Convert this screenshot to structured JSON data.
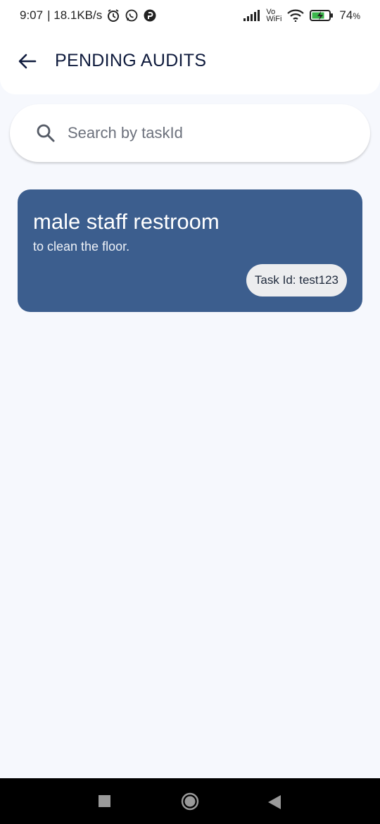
{
  "status_bar": {
    "time": "9:07",
    "speed": "| 18.1KB/s",
    "network_top": "Vo",
    "network_bottom": "WiFi",
    "battery": "74"
  },
  "header": {
    "title": "PENDING AUDITS"
  },
  "search": {
    "placeholder": "Search by taskId",
    "value": ""
  },
  "tasks": [
    {
      "title": "male staff restroom",
      "description": "to clean the floor.",
      "task_id": "Task Id: test123"
    }
  ],
  "colors": {
    "card": "#3c5e8e",
    "title": "#0f1b3d",
    "background": "#f6f8fd",
    "badge": "#ecedef"
  }
}
